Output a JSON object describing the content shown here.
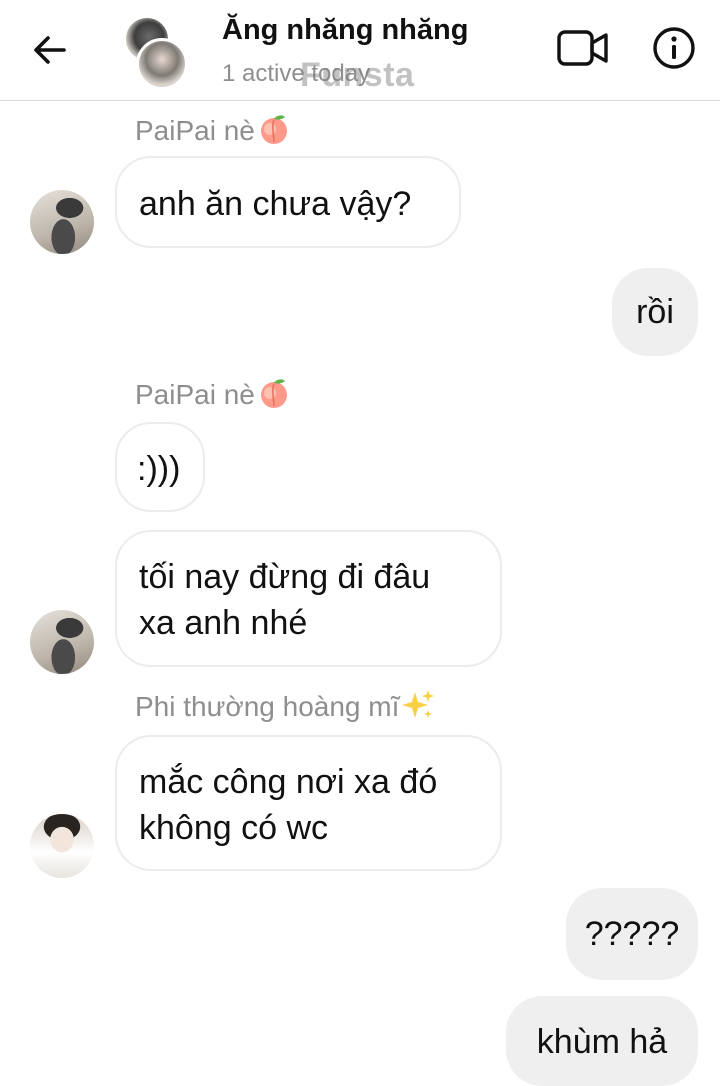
{
  "header": {
    "title": "Ăng nhăng nhăng",
    "status": "1 active today",
    "watermark": "Funsta",
    "back_icon": "arrow-left-icon",
    "video_icon": "video-camera-icon",
    "info_icon": "info-circle-icon"
  },
  "messages": [
    {
      "sender": "PaiPai nè",
      "sender_emoji": "peach",
      "text": "anh ăn chưa vậy?",
      "direction": "incoming"
    },
    {
      "text": "rồi",
      "direction": "outgoing"
    },
    {
      "sender": "PaiPai nè",
      "sender_emoji": "peach",
      "text": ":)))",
      "direction": "incoming"
    },
    {
      "text_line1": "tối nay đừng đi đâu",
      "text_line2": "xa anh nhé",
      "direction": "incoming"
    },
    {
      "sender": "Phi thường hoàng mĩ",
      "sender_emoji": "sparkles",
      "text_line1": "mắc công nơi xa đó",
      "text_line2": "không có wc",
      "direction": "incoming"
    },
    {
      "text": "?????",
      "direction": "outgoing"
    },
    {
      "text": "khùm hả",
      "direction": "outgoing"
    }
  ],
  "colors": {
    "outgoing_bubble": "#efefef",
    "incoming_border": "#ececec",
    "muted_text": "#8e8e8e"
  }
}
